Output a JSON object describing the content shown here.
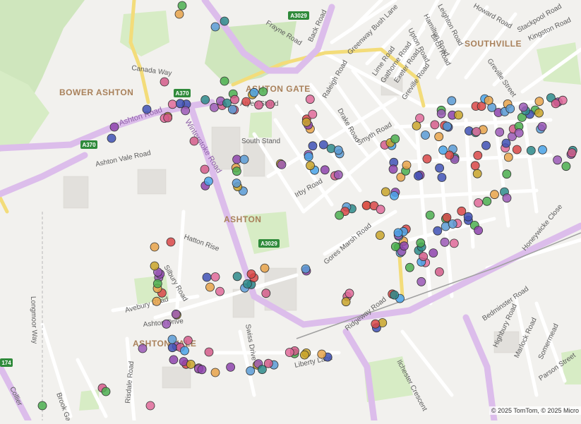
{
  "map": {
    "attribution": "© 2025 TomTom, © 2025 Micro",
    "colors": {
      "background": "#f2f1ee",
      "park": "#c9e4b4",
      "main_road": "#d9b8ea",
      "secondary_road": "#ffffff",
      "a_road": "#f6e27a",
      "shield": "#2f8a3a",
      "area_label": "#a9815b"
    },
    "areas": [
      "BOWER ASHTON",
      "ASHTON GATE",
      "SOUTHVILLE",
      "ASHTON",
      "ASHTON VALE"
    ],
    "shields": [
      "A3029",
      "A370",
      "A370",
      "A3029",
      "174"
    ],
    "streets": [
      "Canada Way",
      "Ashton Road",
      "Ashton Vale Road",
      "Winterstoke Road",
      "Frayne Road",
      "Back Road",
      "Greenway Bush Lane",
      "Leighton Road",
      "Howard Road",
      "Stackpool Road",
      "Kingston Road",
      "Hamilton Road",
      "Upton Road",
      "Birch Road",
      "Lime Road",
      "Gathorne Road",
      "Exeter Road",
      "Greville Road",
      "Greville Street",
      "Raleigh Road",
      "Drake Road",
      "Smyth Road",
      "Irby Road",
      "Gores Marsh Road",
      "Ashton Drive",
      "Avebury Road",
      "Swiss Drive",
      "Liberty Lane",
      "Longmoor Way",
      "Ridgeway Road",
      "Ilchester Crescent",
      "Bedminster Road",
      "Highbury Road",
      "Marlock Road",
      "Somermead",
      "Parson Street",
      "Honeywicke Close",
      "Collier",
      "Silbury Road",
      "Hatton Rise",
      "Bishop Road",
      "Brook Gate",
      "Risdale Road"
    ],
    "poi_labels": [
      "Atyeo Stand",
      "South Stand"
    ]
  }
}
